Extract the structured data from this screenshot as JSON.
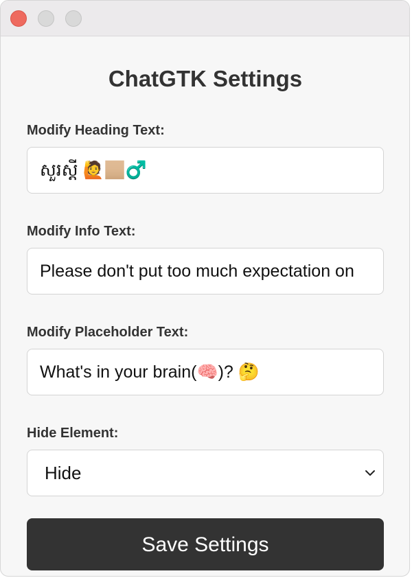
{
  "window": {
    "title": "ChatGTK Settings",
    "controls": [
      "close",
      "minimize",
      "maximize"
    ]
  },
  "colors": {
    "close_button": "#ee6a5f",
    "button_background": "#333333",
    "button_text": "#ffffff",
    "page_background": "#f7f7f7"
  },
  "fields": {
    "heading": {
      "label": "Modify Heading Text:",
      "value": "សួរស្តី 🙋🏼‍♂️"
    },
    "info": {
      "label": "Modify Info Text:",
      "value": "Please don't put too much expectation on"
    },
    "placeholder": {
      "label": "Modify Placeholder Text:",
      "value": "What's in your brain(🧠)? 🤔"
    },
    "hide": {
      "label": "Hide Element:",
      "selected": "Hide",
      "icon": "chevron-down-icon"
    }
  },
  "actions": {
    "save_label": "Save Settings"
  }
}
